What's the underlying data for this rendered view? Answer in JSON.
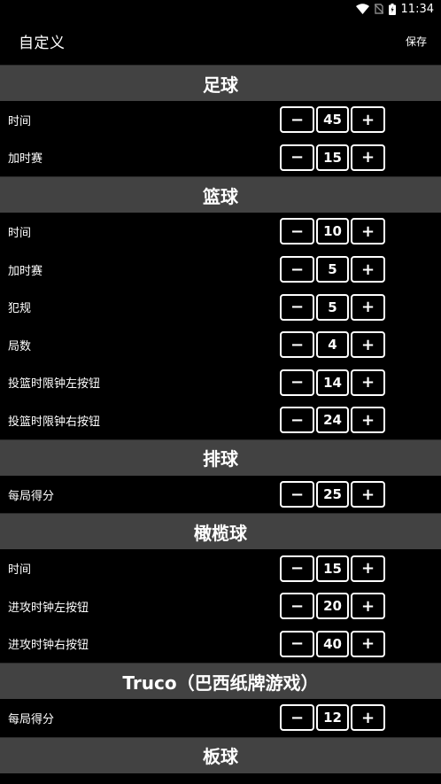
{
  "status_bar": {
    "time": "11:34",
    "icons": [
      "wifi-icon",
      "no-sim-icon",
      "battery-charging-icon"
    ]
  },
  "app_bar": {
    "title": "自定义",
    "save_label": "保存"
  },
  "controls": {
    "minus": "−",
    "plus": "+"
  },
  "sections": [
    {
      "title": "足球",
      "rows": [
        {
          "label": "时间",
          "value": "45"
        },
        {
          "label": "加时赛",
          "value": "15"
        }
      ]
    },
    {
      "title": "篮球",
      "rows": [
        {
          "label": "时间",
          "value": "10"
        },
        {
          "label": "加时赛",
          "value": "5"
        },
        {
          "label": "犯规",
          "value": "5"
        },
        {
          "label": "局数",
          "value": "4"
        },
        {
          "label": "投篮时限钟左按钮",
          "value": "14"
        },
        {
          "label": "投篮时限钟右按钮",
          "value": "24"
        }
      ]
    },
    {
      "title": "排球",
      "rows": [
        {
          "label": "每局得分",
          "value": "25"
        }
      ]
    },
    {
      "title": "橄榄球",
      "rows": [
        {
          "label": "时间",
          "value": "15"
        },
        {
          "label": "进攻时钟左按钮",
          "value": "20"
        },
        {
          "label": "进攻时钟右按钮",
          "value": "40"
        }
      ]
    },
    {
      "title": "Truco（巴西纸牌游戏）",
      "rows": [
        {
          "label": "每局得分",
          "value": "12"
        }
      ]
    },
    {
      "title": "板球",
      "rows": []
    }
  ]
}
